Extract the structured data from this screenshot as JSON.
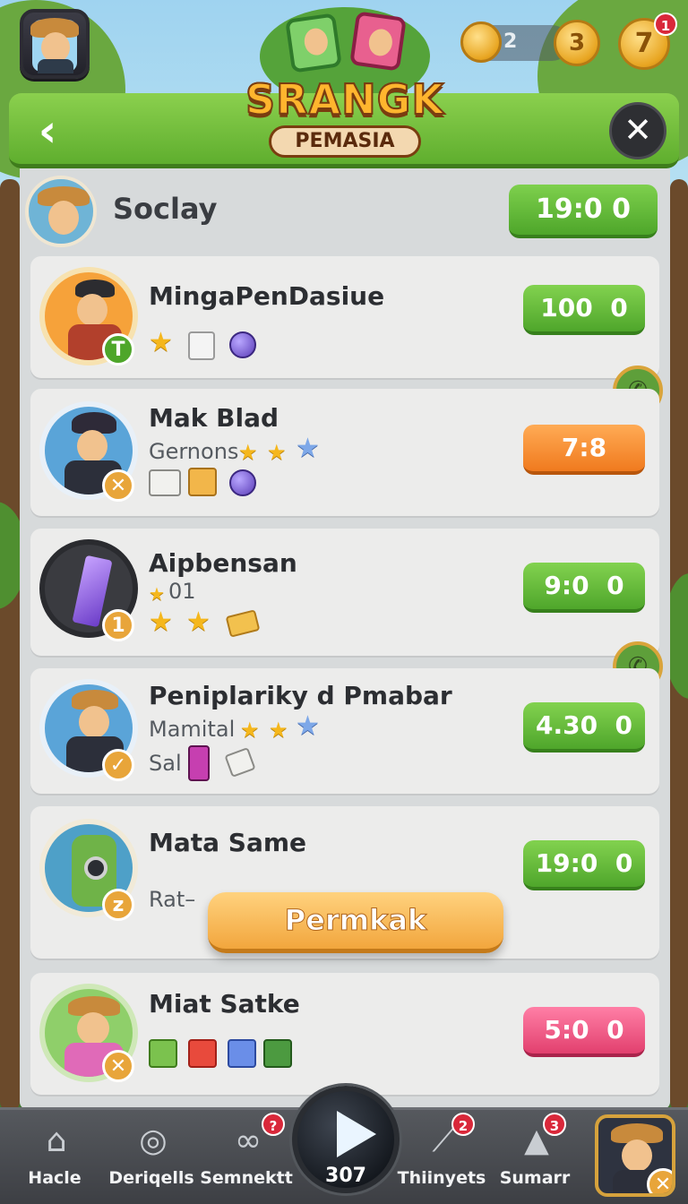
{
  "hud": {
    "coin_count": "2",
    "coin_badge_value": "3",
    "hint_badge_value": "7",
    "hint_notification": "1"
  },
  "logo": {
    "title": "SRANGK",
    "subtitle": "PEMASIA"
  },
  "header": {
    "back_label": "‹",
    "close_label": "✕"
  },
  "self_row": {
    "name": "Soclay",
    "timer": "19:0  0"
  },
  "players": [
    {
      "name": "MingaPenDasiue",
      "subtitle": "",
      "extra": "",
      "timer": "100  0",
      "badge": "T"
    },
    {
      "name": "Mak Blad",
      "subtitle": "Gernons",
      "extra": "",
      "timer": "7:8",
      "badge": "✕"
    },
    {
      "name": "Aipbensan",
      "subtitle": "01",
      "extra": "",
      "timer": "9:0  0",
      "badge": "1"
    },
    {
      "name": "Peniplariky  d Pmabar",
      "subtitle": "Mamital",
      "extra": "Sal",
      "timer": "4.30  0",
      "badge": "✓"
    },
    {
      "name": "Mata Same",
      "subtitle": "Rat–",
      "extra": "",
      "timer": "19:0  0",
      "badge": "z"
    },
    {
      "name": "Miat Satke",
      "subtitle": "",
      "extra": "",
      "timer": "5:0  0",
      "badge": "✕"
    }
  ],
  "popup": {
    "label": "Permkak"
  },
  "nav": {
    "items": [
      {
        "label": "Hacle",
        "icon": "home-icon"
      },
      {
        "label": "Deriqells",
        "icon": "target-icon"
      },
      {
        "label": "Semnektt",
        "icon": "link-icon",
        "badge": "?"
      },
      {
        "label": "Thiinyets",
        "icon": "chart-icon",
        "badge": "2"
      },
      {
        "label": "Sumarr",
        "icon": "bell-icon",
        "badge": "3"
      }
    ],
    "play_count": "307"
  },
  "colors": {
    "green_button": "#4fa62b",
    "orange_button": "#f07a1e",
    "pink_button": "#e2406e",
    "header_green": "#5fae2e"
  }
}
